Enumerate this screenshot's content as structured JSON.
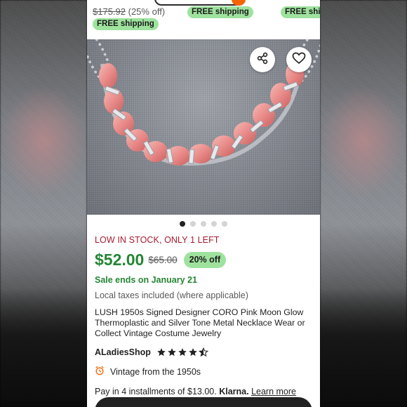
{
  "previous_listing": {
    "old_price": "$175.92",
    "discount_text": "(25% off)",
    "shipping_badges": [
      "FREE shipping",
      "FREE shipping",
      "FREE ship"
    ]
  },
  "image": {
    "share_icon": "share-icon",
    "favorite_icon": "heart-icon",
    "carousel_count": 5,
    "carousel_active": 0
  },
  "listing": {
    "stock": "LOW IN STOCK, ONLY 1 LEFT",
    "price": "$52.00",
    "original_price": "$65.00",
    "discount": "20% off",
    "sale_ends": "Sale ends on January 21",
    "tax_note": "Local taxes included (where applicable)",
    "title": "LUSH 1950s Signed Designer CORO Pink Moon Glow Thermoplastic and Silver Tone Metal Necklace Wear or Collect Vintage Costume Jewelry",
    "shop": "ALadiesShop",
    "rating": 4.5,
    "vintage": "Vintage from the 1950s",
    "installments_text": "Pay in 4 installments of $13.00.",
    "klarna": "Klarna.",
    "learn_more": "Learn more"
  },
  "colors": {
    "price_green": "#258635",
    "badge_green": "#9ee29e",
    "stock_red": "#a61a2e",
    "dark": "#222222"
  }
}
